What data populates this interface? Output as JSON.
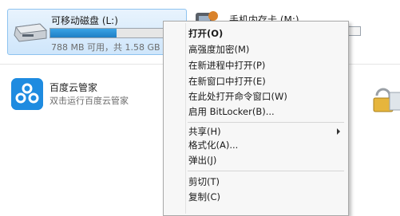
{
  "drives": {
    "removable": {
      "name": "可移动磁盘 (L:)",
      "space_text": "788 MB 可用，共 1.58 GB",
      "used_fraction": 0.51
    },
    "phone": {
      "name": "手机内存卡 (M:)"
    }
  },
  "apps": {
    "baidu": {
      "name": "百度云管家",
      "description": "双击运行百度云管家"
    }
  },
  "context_menu": {
    "items": [
      {
        "label": "打开(O)"
      },
      {
        "label": "高强度加密(M)"
      },
      {
        "label": "在新进程中打开(P)"
      },
      {
        "label": "在新窗口中打开(E)"
      },
      {
        "label": "在此处打开命令窗口(W)"
      },
      {
        "label": "启用 BitLocker(B)..."
      },
      {
        "label": "共享(H)"
      },
      {
        "label": "格式化(A)..."
      },
      {
        "label": "弹出(J)"
      },
      {
        "label": "剪切(T)"
      },
      {
        "label": "复制(C)"
      }
    ]
  },
  "icons": {
    "drive": "removable-drive-icon",
    "phone": "phone-card-icon",
    "app": "baidu-cloud-icon",
    "lock": "bitlocker-lock-icon"
  },
  "colors": {
    "selection": "#cfe6fb",
    "progress": "#1f7fc4",
    "menu_bg": "#f7f7f7"
  }
}
